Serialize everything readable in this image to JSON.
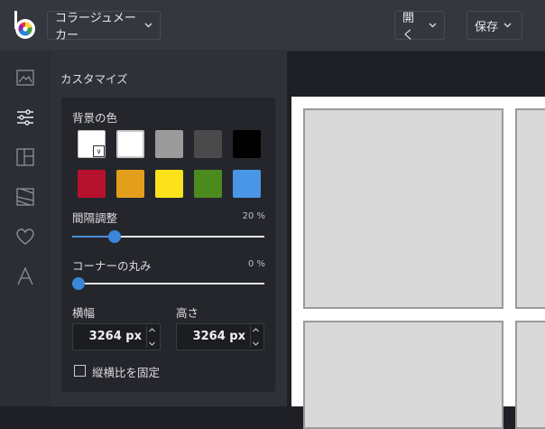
{
  "header": {
    "tool_label": "コラージュメーカー",
    "open_label": "開く",
    "save_label": "保存"
  },
  "panel": {
    "title": "カスタマイズ",
    "background_label": "背景の色",
    "swatches_row1": [
      "#ffffff",
      "#ffffff",
      "#9b9b9b",
      "#4a4a4a",
      "#000000"
    ],
    "swatches_row2": [
      "#b5122e",
      "#e39e1b",
      "#fbe21c",
      "#4b8a1f",
      "#4a96e6"
    ],
    "selected_swatch_marker": "∨",
    "spacing_label": "間隔調整",
    "spacing_value": "20 %",
    "spacing_level": 0.22,
    "corner_label": "コーナーの丸み",
    "corner_value": "0 %",
    "corner_level": 0.0,
    "width_label": "横幅",
    "width_value": "3264 px",
    "height_label": "高さ",
    "height_value": "3264 px",
    "lock_ratio_label": "縦横比を固定",
    "lock_ratio_checked": false
  },
  "sidebar_icons": [
    "image-icon",
    "sliders-icon",
    "layout-icon",
    "texture-icon",
    "heart-icon",
    "text-icon"
  ],
  "colors": {
    "accent": "#3a86d8",
    "topbar": "#35373f",
    "panel": "#2f3138"
  }
}
